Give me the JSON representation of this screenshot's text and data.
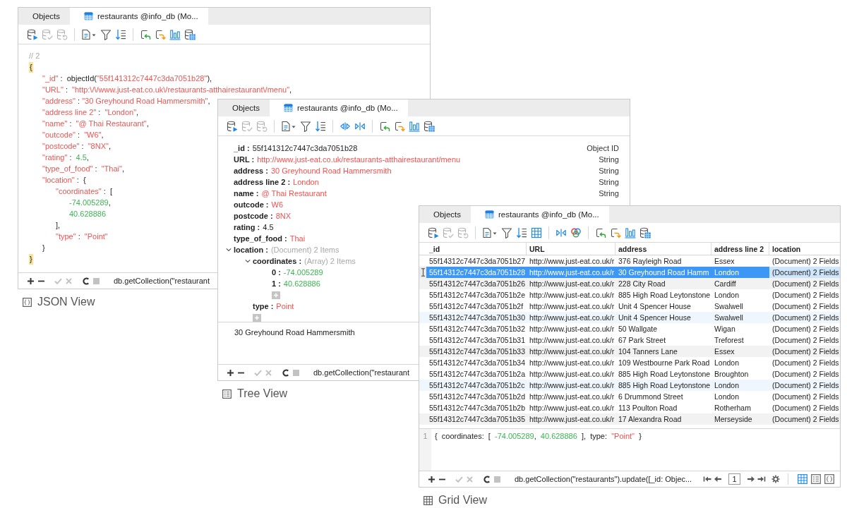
{
  "windows": [
    {
      "kind": "json",
      "tabs": [
        {
          "kind": "objects",
          "label": "Objects",
          "selected": false
        },
        {
          "kind": "collection",
          "label": "restaurants @info_db (Mo...",
          "selected": true
        }
      ],
      "toolbar": [
        [
          {
            "kind": "db-run",
            "disabled": false
          },
          {
            "kind": "db-check",
            "disabled": true
          },
          {
            "kind": "db-undo",
            "disabled": true
          }
        ],
        [
          {
            "kind": "document-menu",
            "disabled": false
          },
          {
            "kind": "filter",
            "disabled": false
          },
          {
            "kind": "sort",
            "disabled": false
          }
        ],
        [
          {
            "kind": "reload-back",
            "disabled": false
          },
          {
            "kind": "reload-forward",
            "disabled": false
          },
          {
            "kind": "chart",
            "disabled": false
          },
          {
            "kind": "db-table",
            "disabled": false
          }
        ]
      ],
      "document": {
        "comment": "// 2",
        "open": "{",
        "close": "}",
        "brace_match": true,
        "lines": [
          {
            "tokens": [
              {
                "kind": "key",
                "text": "\"_id\""
              },
              {
                "kind": "plain",
                "text": " :  objectId("
              },
              {
                "kind": "string",
                "text": "\"55f141312c7447c3da7051b28\""
              },
              {
                "kind": "plain",
                "text": "),"
              }
            ]
          },
          {
            "tokens": [
              {
                "kind": "key",
                "text": "\"URL\""
              },
              {
                "kind": "plain",
                "text": " :  "
              },
              {
                "kind": "string",
                "text": "\"http:\\/\\/www.just-eat.co.uk\\/restaurants-atthairestaurant\\/menu\""
              },
              {
                "kind": "plain",
                "text": ","
              }
            ]
          },
          {
            "tokens": [
              {
                "kind": "key",
                "text": "\"address\""
              },
              {
                "kind": "plain",
                "text": " : "
              },
              {
                "kind": "string",
                "text": "\"30 Greyhound Road Hammersmith\""
              },
              {
                "kind": "plain",
                "text": ","
              }
            ]
          },
          {
            "tokens": [
              {
                "kind": "key",
                "text": "\"address line 2\""
              },
              {
                "kind": "plain",
                "text": " :  "
              },
              {
                "kind": "string",
                "text": "\"London\""
              },
              {
                "kind": "plain",
                "text": ","
              }
            ]
          },
          {
            "tokens": [
              {
                "kind": "key",
                "text": "\"name\""
              },
              {
                "kind": "plain",
                "text": " :  "
              },
              {
                "kind": "string",
                "text": "\"@ Thai Restaurant\""
              },
              {
                "kind": "plain",
                "text": ","
              }
            ]
          },
          {
            "tokens": [
              {
                "kind": "key",
                "text": "\"outcode\""
              },
              {
                "kind": "plain",
                "text": " :  "
              },
              {
                "kind": "string",
                "text": "\"W6\""
              },
              {
                "kind": "plain",
                "text": ","
              }
            ]
          },
          {
            "tokens": [
              {
                "kind": "key",
                "text": "\"postcode\""
              },
              {
                "kind": "plain",
                "text": " :  "
              },
              {
                "kind": "string",
                "text": "\"8NX\""
              },
              {
                "kind": "plain",
                "text": ","
              }
            ]
          },
          {
            "tokens": [
              {
                "kind": "key",
                "text": "\"rating\""
              },
              {
                "kind": "plain",
                "text": " :  "
              },
              {
                "kind": "number",
                "text": "4.5"
              },
              {
                "kind": "plain",
                "text": ","
              }
            ]
          },
          {
            "tokens": [
              {
                "kind": "key",
                "text": "\"type_of_food\""
              },
              {
                "kind": "plain",
                "text": " :  "
              },
              {
                "kind": "string",
                "text": "\"Thai\""
              },
              {
                "kind": "plain",
                "text": ","
              }
            ]
          },
          {
            "tokens": [
              {
                "kind": "key",
                "text": "\"location\""
              },
              {
                "kind": "plain",
                "text": " :  {"
              }
            ],
            "close": "}",
            "children": [
              {
                "tokens": [
                  {
                    "kind": "key",
                    "text": "\"coordinates\""
                  },
                  {
                    "kind": "plain",
                    "text": " :  ["
                  }
                ],
                "close": "],",
                "children": [
                  {
                    "tokens": [
                      {
                        "kind": "number",
                        "text": "-74.005289"
                      },
                      {
                        "kind": "plain",
                        "text": ","
                      }
                    ]
                  },
                  {
                    "tokens": [
                      {
                        "kind": "number",
                        "text": "40.628886"
                      }
                    ]
                  }
                ]
              },
              {
                "tokens": [
                  {
                    "kind": "key",
                    "text": "\"type\""
                  },
                  {
                    "kind": "plain",
                    "text": " :  "
                  },
                  {
                    "kind": "string",
                    "text": "\"Point\""
                  }
                ]
              }
            ]
          }
        ]
      },
      "actions": [
        [
          {
            "kind": "add",
            "disabled": false
          },
          {
            "kind": "remove",
            "disabled": false
          }
        ],
        [
          {
            "kind": "apply",
            "disabled": true
          },
          {
            "kind": "discard",
            "disabled": true
          }
        ],
        [
          {
            "kind": "refresh",
            "disabled": false
          },
          {
            "kind": "stop",
            "disabled": true
          }
        ]
      ],
      "query": "db.getCollection(\"restaurant",
      "caption": "JSON View"
    },
    {
      "kind": "tree",
      "tabs": [
        {
          "kind": "objects",
          "label": "Objects",
          "selected": false
        },
        {
          "kind": "collection",
          "label": "restaurants @info_db (Mo...",
          "selected": true
        }
      ],
      "toolbar": [
        [
          {
            "kind": "db-run",
            "disabled": false
          },
          {
            "kind": "db-check",
            "disabled": true
          },
          {
            "kind": "db-undo",
            "disabled": true
          }
        ],
        [
          {
            "kind": "document-menu",
            "disabled": false
          },
          {
            "kind": "filter",
            "disabled": false
          },
          {
            "kind": "sort",
            "disabled": false
          }
        ],
        [
          {
            "kind": "arrows-apart",
            "disabled": false
          },
          {
            "kind": "arrows-together",
            "disabled": false
          }
        ],
        [
          {
            "kind": "reload-back",
            "disabled": false
          },
          {
            "kind": "reload-forward",
            "disabled": false
          },
          {
            "kind": "chart",
            "disabled": false
          },
          {
            "kind": "db-table",
            "disabled": false
          }
        ]
      ],
      "tree": {
        "nodes": [
          {
            "key": "_id :",
            "value": "55f141312c7447c3da7051b28",
            "kind": "plain",
            "type": "Object ID"
          },
          {
            "key": "URL :",
            "value": "http://www.just-eat.co.uk/restaurants-atthairestaurant/menu",
            "kind": "string",
            "type": "String"
          },
          {
            "key": "address :",
            "value": "30 Greyhound Road Hammersmith",
            "kind": "string",
            "type": "String"
          },
          {
            "key": "address line 2 :",
            "value": "London",
            "kind": "string",
            "type": "String"
          },
          {
            "key": "name :",
            "value": "@ Thai Restaurant",
            "kind": "string",
            "type": "String"
          },
          {
            "key": "outcode :",
            "value": "W6",
            "kind": "string"
          },
          {
            "key": "postcode :",
            "value": "8NX",
            "kind": "string"
          },
          {
            "key": "rating :",
            "value": "4.5",
            "kind": "plain"
          },
          {
            "key": "type_of_food :",
            "value": "Thai",
            "kind": "string"
          },
          {
            "key": "location :",
            "value": "(Document) 2 Items",
            "kind": "meta",
            "expanded": true,
            "children": [
              {
                "key": "coordinates :",
                "value": "(Array) 2 Items",
                "kind": "meta",
                "expanded": true,
                "children": [
                  {
                    "key": "0 :",
                    "value": "-74.005289",
                    "kind": "number"
                  },
                  {
                    "key": "1 :",
                    "value": "40.628886",
                    "kind": "number"
                  }
                ]
              },
              {
                "key": "type :",
                "value": "Point",
                "kind": "string"
              }
            ]
          }
        ]
      },
      "preview_text": "30 Greyhound Road Hammersmith",
      "actions": [
        [
          {
            "kind": "add",
            "disabled": false
          },
          {
            "kind": "remove",
            "disabled": false
          }
        ],
        [
          {
            "kind": "apply",
            "disabled": true
          },
          {
            "kind": "discard",
            "disabled": true
          }
        ],
        [
          {
            "kind": "refresh",
            "disabled": false
          },
          {
            "kind": "stop",
            "disabled": true
          }
        ]
      ],
      "query": "db.getCollection(\"restaurant",
      "caption": "Tree View"
    },
    {
      "kind": "grid",
      "tabs": [
        {
          "kind": "objects",
          "label": "Objects",
          "selected": false
        },
        {
          "kind": "collection",
          "label": "restaurants @info_db (Mo...",
          "selected": true
        }
      ],
      "toolbar": [
        [
          {
            "kind": "db-run",
            "disabled": false
          },
          {
            "kind": "db-check",
            "disabled": true
          },
          {
            "kind": "db-undo",
            "disabled": true
          }
        ],
        [
          {
            "kind": "document-menu",
            "disabled": false
          },
          {
            "kind": "filter",
            "disabled": false
          },
          {
            "kind": "sort",
            "disabled": false
          },
          {
            "kind": "grid",
            "disabled": false
          }
        ],
        [
          {
            "kind": "arrows-together",
            "disabled": false
          },
          {
            "kind": "color-rings",
            "disabled": false
          }
        ],
        [
          {
            "kind": "reload-back",
            "disabled": false
          },
          {
            "kind": "reload-forward",
            "disabled": false
          },
          {
            "kind": "chart",
            "disabled": false
          },
          {
            "kind": "db-table",
            "disabled": false
          }
        ]
      ],
      "grid": {
        "columns": [
          {
            "label": "_id",
            "current": false
          },
          {
            "label": "URL",
            "current": false
          },
          {
            "label": "address",
            "current": false
          },
          {
            "label": "address line 2",
            "current": false
          },
          {
            "label": "location",
            "current": true
          }
        ],
        "rows": [
          {
            "cells": [
              "55f14312c7447c3da7051b27",
              "http://www.just-eat.co.uk/r",
              "376 Rayleigh Road",
              "Essex",
              "(Document) 2 Fields"
            ],
            "selected": false,
            "color": "#ffffff"
          },
          {
            "cells": [
              "55f14312c7447c3da7051b28",
              "http://www.just-eat.co.uk/r",
              "30 Greyhound Road Hamm",
              "London",
              "(Document) 2 Fields"
            ],
            "selected": true
          },
          {
            "cells": [
              "55f14312c7447c3da7051b26",
              "http://www.just-eat.co.uk/r",
              "228 City Road",
              "Cardiff",
              "(Document) 2 Fields"
            ],
            "selected": false,
            "color": "#f2f2f2"
          },
          {
            "cells": [
              "55f14312c7447c3da7051b2e",
              "http://www.just-eat.co.uk/r",
              "885 High Road Leytonstone",
              "London",
              "(Document) 2 Fields"
            ],
            "selected": false,
            "color": "#ffffff"
          },
          {
            "cells": [
              "55f14312c7447c3da7051b2f",
              "http://www.just-eat.co.uk/r",
              "Unit 4 Spencer House",
              "Swalwell",
              "(Document) 2 Fields"
            ],
            "selected": false,
            "color": "#ffffff"
          },
          {
            "cells": [
              "55f14312c7447c3da7051b30",
              "http://www.just-eat.co.uk/r",
              "Unit 4 Spencer House",
              "Swalwell",
              "(Document) 2 Fields"
            ],
            "selected": false,
            "color": "#eff6fe"
          },
          {
            "cells": [
              "55f14312c7447c3da7051b32",
              "http://www.just-eat.co.uk/r",
              "50 Wallgate",
              "Wigan",
              "(Document) 2 Fields"
            ],
            "selected": false,
            "color": "#ffffff"
          },
          {
            "cells": [
              "55f14312c7447c3da7051b31",
              "http://www.just-eat.co.uk/r",
              "67 Park Street",
              "Treforest",
              "(Document) 2 Fields"
            ],
            "selected": false,
            "color": "#ffffff"
          },
          {
            "cells": [
              "55f14312c7447c3da7051b33",
              "http://www.just-eat.co.uk/r",
              "104 Tanners Lane",
              "Essex",
              "(Document) 2 Fields"
            ],
            "selected": false,
            "color": "#f2f2f2"
          },
          {
            "cells": [
              "55f14312c7447c3da7051b34",
              "http://www.just-eat.co.uk/r",
              "109 Westbourne Park Road",
              "London",
              "(Document) 2 Fields"
            ],
            "selected": false,
            "color": "#ffffff"
          },
          {
            "cells": [
              "55f14312c7447c3da7051b2a",
              "http://www.just-eat.co.uk/r",
              "885 High Road Leytonstone",
              "Broughton",
              "(Document) 2 Fields"
            ],
            "selected": false,
            "color": "#ffffff"
          },
          {
            "cells": [
              "55f14312c7447c3da7051b2c",
              "http://www.just-eat.co.uk/r",
              "885 High Road Leytonstone",
              "London",
              "(Document) 2 Fields"
            ],
            "selected": false,
            "color": "#eff6fe"
          },
          {
            "cells": [
              "55f14312c7447c3da7051b2d",
              "http://www.just-eat.co.uk/r",
              "6 Drummond Street",
              "London",
              "(Document) 2 Fields"
            ],
            "selected": false,
            "color": "#ffffff"
          },
          {
            "cells": [
              "55f14312c7447c3da7051b2b",
              "http://www.just-eat.co.uk/r",
              "113 Poulton Road",
              "Rotherham",
              "(Document) 2 Fields"
            ],
            "selected": false,
            "color": "#ffffff"
          },
          {
            "cells": [
              "55f14312c7447c3da7051b35",
              "http://www.just-eat.co.uk/r",
              "17 Alexandra Road",
              "Merseyside",
              "(Document) 2 Fields"
            ],
            "selected": false,
            "color": "#f2f2f2"
          }
        ]
      },
      "preview_code": {
        "line_number": "1",
        "tokens": [
          {
            "kind": "plain",
            "text": "{  coordinates:  [  "
          },
          {
            "kind": "number",
            "text": "-74.005289"
          },
          {
            "kind": "plain",
            "text": ",  "
          },
          {
            "kind": "number",
            "text": "40.628886"
          },
          {
            "kind": "plain",
            "text": "  ],  type:  "
          },
          {
            "kind": "string",
            "text": "\"Point\""
          },
          {
            "kind": "plain",
            "text": "  }"
          }
        ]
      },
      "actions": [
        [
          {
            "kind": "add",
            "disabled": false
          },
          {
            "kind": "remove",
            "disabled": false
          }
        ],
        [
          {
            "kind": "apply",
            "disabled": true
          },
          {
            "kind": "discard",
            "disabled": true
          }
        ],
        [
          {
            "kind": "refresh",
            "disabled": false
          },
          {
            "kind": "stop",
            "disabled": true
          }
        ]
      ],
      "query": "db.getCollection(\"restaurants\").update([_id: Objec...",
      "pager": {
        "page": "1"
      },
      "views": [
        {
          "kind": "grid",
          "selected": true
        },
        {
          "kind": "tree",
          "selected": false
        },
        {
          "kind": "json",
          "selected": false
        }
      ],
      "caption": "Grid View"
    }
  ]
}
